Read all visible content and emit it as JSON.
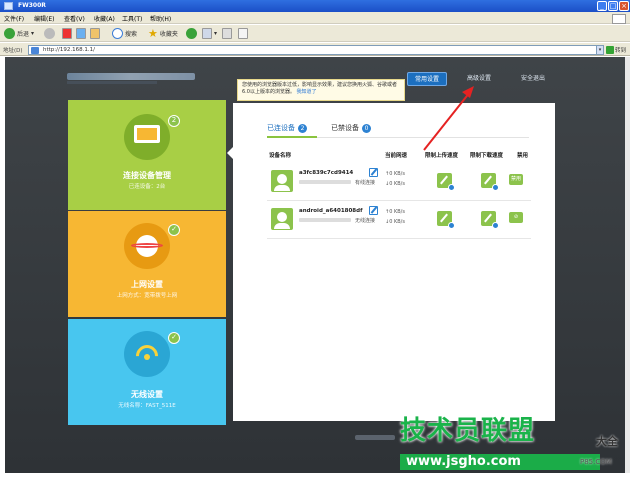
{
  "window": {
    "title": "FW300R"
  },
  "menu": [
    "文件(F)",
    "编辑(E)",
    "查看(V)",
    "收藏(A)",
    "工具(T)",
    "帮助(H)"
  ],
  "toolbar": {
    "back": "后退",
    "search": "搜索",
    "favorites": "收藏夹"
  },
  "address": {
    "label": "地址(D)",
    "url": "http://192.168.1.1/",
    "go": "转到"
  },
  "notice": {
    "text": "您使用的浏览器版本过低，影响显示效果，建议您换用火狐、谷歌或者6.0以上版本的浏览器。",
    "link": "我知道了"
  },
  "topnav": {
    "basic": "常用设置",
    "advanced": "高级设置",
    "logout": "安全退出"
  },
  "tiles": [
    {
      "title": "连接设备管理",
      "sub": "已连设备：2台",
      "color": "#a8cf45"
    },
    {
      "title": "上网设置",
      "sub": "上网方式：宽带拨号上网",
      "color": "#f7b733"
    },
    {
      "title": "无线设置",
      "sub": "无线名称：FAST_511E",
      "color": "#48c6ef"
    }
  ],
  "tabs": [
    {
      "label": "已连设备",
      "count": "2"
    },
    {
      "label": "已禁设备",
      "count": "0"
    }
  ],
  "columns": [
    "设备名称",
    "当前网速",
    "限制上传速度",
    "限制下载速度",
    "禁用"
  ],
  "devices": [
    {
      "name": "a3fc839c7cd9414",
      "type": "有线连接",
      "up": "0 KB/s",
      "down": "0 KB/s",
      "ban": "禁用"
    },
    {
      "name": "android_a6401808df",
      "type": "无线连接",
      "up": "0 KB/s",
      "down": "0 KB/s",
      "ban": ""
    }
  ],
  "watermark": {
    "brand": "技术员联盟",
    "suffix": "大全",
    "url": "www.jsgho.com",
    "tail": "P85.COM"
  },
  "colors": {
    "accent": "#1c6fbf",
    "green": "#8cc34c"
  }
}
